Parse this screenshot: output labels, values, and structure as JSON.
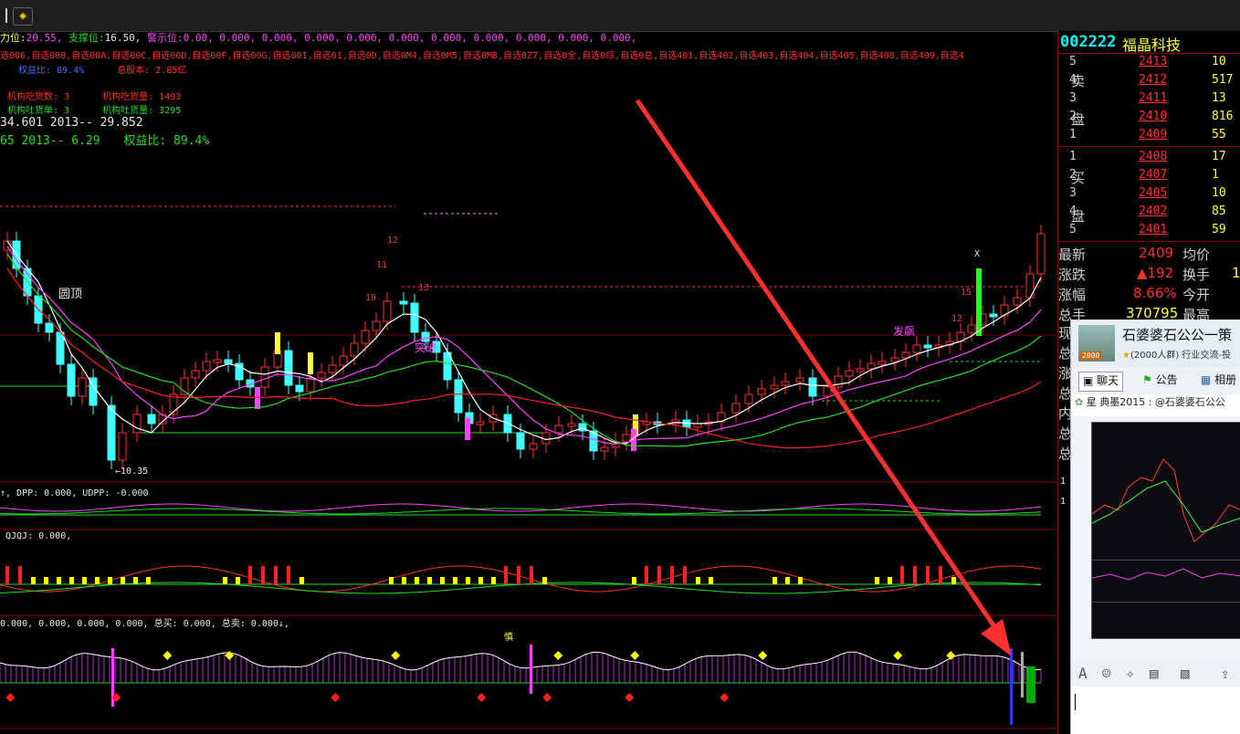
{
  "toolbar": {
    "sep_label": "|",
    "tool_icon": "diamond-question-icon"
  },
  "header": {
    "line1": {
      "label_press": "力位:",
      "press_val": "20.55,",
      "label_support": "支撑位:",
      "support_val": "16.50,",
      "label_warn": "警示位:",
      "warn_vals": "0.00, 0.000, 0.000, 0.000, 0.000, 0.000, 0.000, 0.000, 0.000, 0.000, 0.000,"
    },
    "line2": "选006,自选008,自选00A,自选00C,自选00D,自选00F,自选00G,自选00I,自选01,自选0D,自选0M4,自选0M5,自选0M8,自选0Z7,自选0全,自选0综,自选0总,自选401,自选402,自选403,自选404,自选405,自选408,自选409,自选4",
    "line3": {
      "equity": "权益比: 89.4%",
      "share": "总股本: 2.85亿"
    },
    "line4": {
      "inst_eat_cnt": "机构吃货数: 3",
      "inst_eat_amt": "机构吃货量: 1493"
    },
    "line5": {
      "inst_spit_cnt": "机构吐货单: 3",
      "inst_spit_amt": "机构吐货量: 3295"
    },
    "line6": "34.601    2013-- 29.852",
    "line7": {
      "a": "65   2013-- 6.29",
      "b": "权益比: 89.4%"
    }
  },
  "annotations": {
    "round_top": "圆顶",
    "low_price": "10.35",
    "break_up": "突破",
    "x_mark": "X",
    "surge": "发飙",
    "n12": "12",
    "n11": "11",
    "n10": "10",
    "n13": "13",
    "n15": "15",
    "n12b": "12"
  },
  "indicators": {
    "dpp": "↑, DPP: 0.000, UDPP: -0.000",
    "qjqj": "QJQJ: 0.000,",
    "vol": "0.000, 0.000, 0.000, 0.000, 总买: 0.000, 总卖: 0.000↓,",
    "shen": "慎"
  },
  "quote": {
    "code": "002222",
    "name": "福晶科技",
    "sell_label_1": "卖",
    "sell_label_2": "盘",
    "buy_label_1": "买",
    "buy_label_2": "盘",
    "sell": [
      {
        "lvl": "5",
        "px": "2413",
        "vol": "10"
      },
      {
        "lvl": "4",
        "px": "2412",
        "vol": "517"
      },
      {
        "lvl": "3",
        "px": "2411",
        "vol": "13"
      },
      {
        "lvl": "2",
        "px": "2410",
        "vol": "816"
      },
      {
        "lvl": "1",
        "px": "2409",
        "vol": "55"
      }
    ],
    "buy": [
      {
        "lvl": "1",
        "px": "2408",
        "vol": "17"
      },
      {
        "lvl": "2",
        "px": "2407",
        "vol": "1"
      },
      {
        "lvl": "3",
        "px": "2405",
        "vol": "10"
      },
      {
        "lvl": "4",
        "px": "2402",
        "vol": "85"
      },
      {
        "lvl": "5",
        "px": "2401",
        "vol": "59"
      }
    ],
    "latest_label": "最新",
    "latest": "2409",
    "avg_label": "均价",
    "chg_label": "涨跌",
    "chg": "▲192",
    "turn_label": "换手",
    "turn_val": "1",
    "pct_label": "涨幅",
    "pct": "8.66%",
    "open_label": "今开",
    "total_label": "总手",
    "total": "370795",
    "high_label": "最高",
    "side_chars": [
      "现",
      "总",
      "涨",
      "总",
      "内",
      "总",
      "总"
    ],
    "mini": [
      "1",
      "1"
    ]
  },
  "chat": {
    "group_name": "石婆婆石公公一策",
    "group_info": "(2000人群) 行业交流-投",
    "tab_chat": "聊天",
    "tab_notice": "公告",
    "tab_album": "相册",
    "msg_sender": "星  典墨2015 : @石婆婆石公公",
    "avatar_badge": "2000"
  },
  "chart_data": {
    "type": "candlestick",
    "title": "",
    "price_range": [
      10.35,
      24.13
    ],
    "annotated_low": 10.35,
    "last": 24.09,
    "change": 1.92,
    "change_pct": 8.66
  },
  "colors": {
    "up": "#ff3030",
    "down": "#40ffff",
    "ma5": "#ffffff",
    "ma10": "#ff40ff",
    "ma20": "#22dd22",
    "ma60": "#ff2020"
  }
}
